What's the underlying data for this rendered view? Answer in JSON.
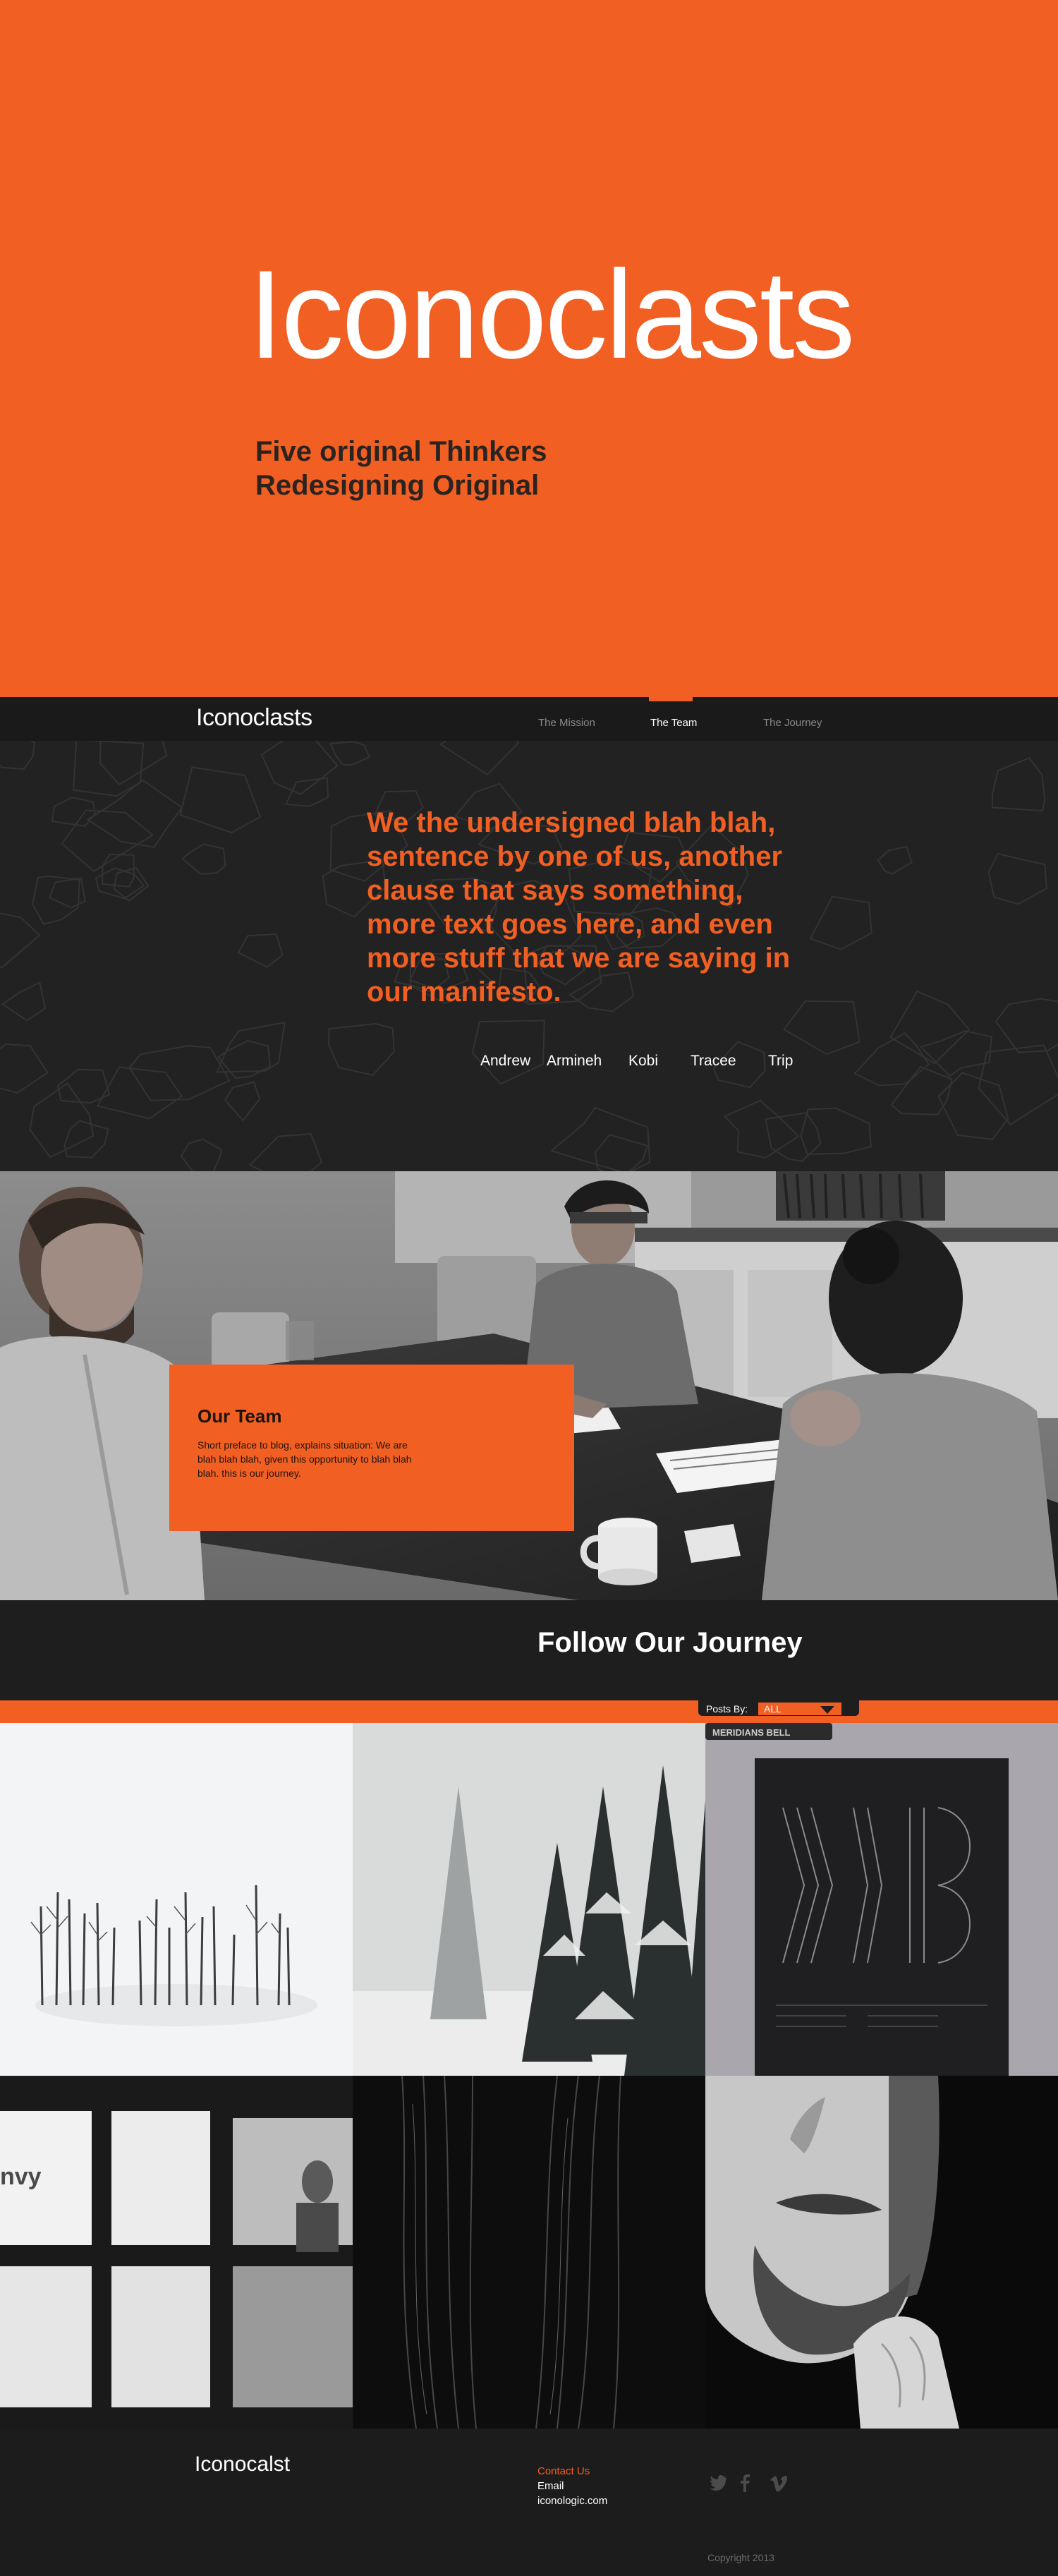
{
  "hero": {
    "title": "Iconoclasts",
    "subtitle_line1": "Five original Thinkers",
    "subtitle_line2": "Redesigning Original"
  },
  "nav": {
    "logo": "Iconoclasts",
    "items": [
      {
        "label": "The Mission",
        "active": false
      },
      {
        "label": "The Team",
        "active": true
      },
      {
        "label": "The Journey",
        "active": false
      }
    ]
  },
  "manifesto": {
    "text": "We the undersigned blah blah, sentence by one of us, another clause that says something, more text goes here, and even more stuff that we are saying in our manifesto.",
    "team": [
      "Andrew",
      "Armineh",
      "Kobi",
      "Tracee",
      "Trip"
    ]
  },
  "team_section": {
    "title": "Our Team",
    "description": "Short preface to blog, explains situation: We are blah blah blah, given this opportunity to blah blah blah. this is our journey."
  },
  "journey": {
    "title": "Follow Our Journey",
    "filter_label": "Posts By:",
    "filter_value": "ALL"
  },
  "grid_tiles": [
    {
      "name": "snowy-trees-tile"
    },
    {
      "name": "foggy-forest-tile"
    },
    {
      "name": "poster-tile",
      "poster_header": "MERIDIANS BELL"
    },
    {
      "name": "window-tile",
      "window_text": "nvy"
    },
    {
      "name": "hair-tile"
    },
    {
      "name": "portrait-tile"
    }
  ],
  "footer": {
    "logo": "Iconocalst",
    "contact_title": "Contact Us",
    "email": "Email",
    "site": "iconologic.com",
    "social": [
      "twitter-icon",
      "facebook-icon",
      "vimeo-icon"
    ],
    "copyright": "Copyright 2013"
  },
  "colors": {
    "accent": "#f15f22",
    "dark": "#1c1c1c",
    "manifesto_bg": "#222222"
  }
}
